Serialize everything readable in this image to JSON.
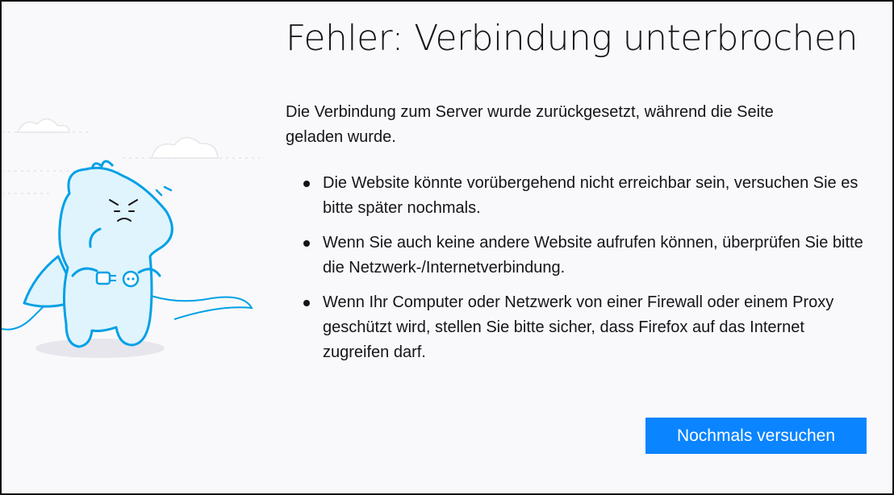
{
  "error_page": {
    "title": "Fehler: Verbindung unterbrochen",
    "description": "Die Verbindung zum Server wurde zurückgesetzt, während die Seite geladen wurde.",
    "suggestions": [
      "Die Website könnte vorübergehend nicht erreichbar sein, versuchen Sie es bitte später nochmals.",
      "Wenn Sie auch keine andere Website aufrufen können, überprüfen Sie bitte die Netzwerk-/Internetverbindung.",
      "Wenn Ihr Computer oder Netzwerk von einer Firewall oder einem Proxy geschützt wird, stellen Sie bitte sicher, dass Firefox auf das Internet zugreifen darf."
    ],
    "retry_button_label": "Nochmals versuchen"
  },
  "colors": {
    "background": "#f9f9fb",
    "accent": "#0a84ff",
    "text": "#15141a",
    "illustration_stroke": "#00a0e6",
    "illustration_fill": "#dff4fd"
  }
}
